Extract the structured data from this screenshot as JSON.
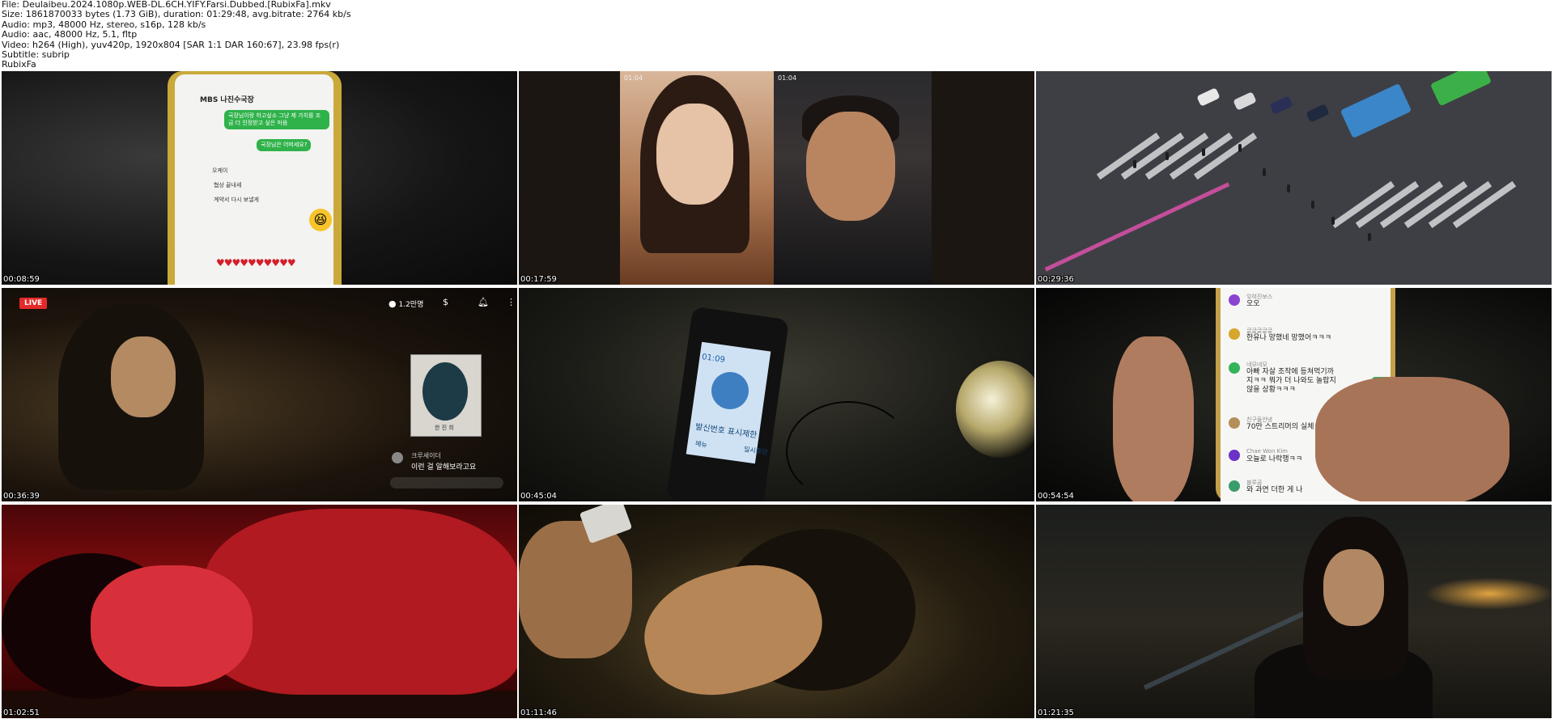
{
  "info": {
    "file": "File: Deulaibeu.2024.1080p.WEB-DL.6CH.YIFY.Farsi.Dubbed.[RubixFa].mkv",
    "size": "Size: 1861870033 bytes (1.73 GiB), duration: 01:29:48, avg.bitrate: 2764 kb/s",
    "audio1": "Audio: mp3, 48000 Hz, stereo, s16p, 128 kb/s",
    "audio2": "Audio: aac, 48000 Hz, 5.1, fltp",
    "video": "Video: h264 (High), yuv420p, 1920x804 [SAR 1:1 DAR 160:67], 23.98 fps(r)",
    "subtitle": "Subtitle: subrip",
    "tag": "RubixFa"
  },
  "thumbs": [
    {
      "timestamp": "00:08:59",
      "chat_title": "MBS 나진수국장",
      "bubble1": "국장님이랑 하고싶소 그냥 제 가치를 조금 더 인정받고 싶은 마음",
      "bubble2": "국장님은 어떠세요?",
      "msg1": "오케이",
      "msg2": "협상 끝내세",
      "msg3": "계약서 다시 보낼게",
      "hearts": "♥♥♥♥♥♥♥♥♥♥",
      "emoji": "😆"
    },
    {
      "timestamp": "00:17:59",
      "call_time_left": "01:04",
      "call_time_right": "01:04"
    },
    {
      "timestamp": "00:29:36"
    },
    {
      "timestamp": "00:36:39",
      "live_label": "LIVE",
      "viewers": "1.2만명",
      "portrait_name": "한 진 희",
      "comment_name": "크루세이더",
      "comment_text": "이런 걸 알해보라고요"
    },
    {
      "timestamp": "00:45:04",
      "clock": "01:09",
      "caller_blocked": "발신번호 표시제한",
      "menu": "메뉴",
      "pause": "일시중단"
    },
    {
      "timestamp": "00:54:54",
      "comments": [
        {
          "name": "잊혀진보스",
          "text": "오오",
          "color": "#8a44d0"
        },
        {
          "name": "글글글글글",
          "text": "한유나 망했네 망했어ㅋㅋㅋ",
          "color": "#d6a72c"
        },
        {
          "name": "네모네모",
          "text": "아빠 자살 조작에 등쳐먹기까\n지ㅋㅋ 뭐가 더 나와도 놀랍지\n않을 상황ㅋㅋㅋ",
          "color": "#35b35a"
        },
        {
          "name": "친구들안녕",
          "text": "70만 스트리머의 실체ㅋ",
          "color": "#b48f58"
        },
        {
          "name": "Chae Won Kim",
          "text": "오늘로 나락행ㅋㅋ",
          "color": "#6b32c6"
        },
        {
          "name": "블루곰",
          "text": "와 과연 더한 게 나",
          "color": "#3b9c6b"
        }
      ]
    },
    {
      "timestamp": "01:02:51"
    },
    {
      "timestamp": "01:11:46"
    },
    {
      "timestamp": "01:21:35"
    }
  ]
}
